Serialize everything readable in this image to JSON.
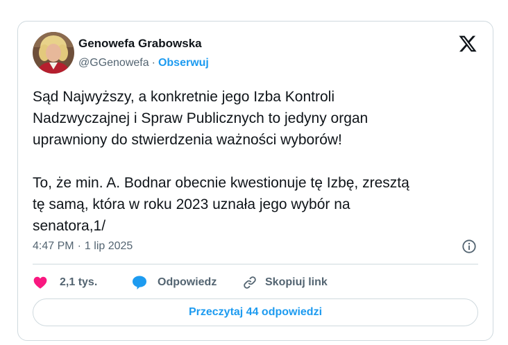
{
  "author": {
    "name": "Genowefa Grabowska",
    "handle": "@GGenowefa",
    "separator": "·",
    "follow_label": "Obserwuj",
    "avatar_icon": "profile-photo"
  },
  "platform_icon": "x-logo-icon",
  "tweet": {
    "text": "Sąd Najwyższy, a konkretnie jego Izba Kontroli\nNadzwyczajnej i Spraw Publicznych to jedyny organ\nuprawniony do stwierdzenia ważności wyborów!\n\nTo, że min. A. Bodnar obecnie kwestionuje tę Izbę, zresztą\ntę samą, która w roku 2023 uznała jego wybór na\nsenatora,1/"
  },
  "meta": {
    "time": "4:47 PM",
    "separator": "·",
    "date": "1 lip 2025"
  },
  "actions": {
    "likes": "2,1 tys.",
    "reply_label": "Odpowiedz",
    "copy_link_label": "Skopiuj link"
  },
  "read_replies_label": "Przeczytaj 44 odpowiedzi",
  "colors": {
    "accent": "#1d9bf0",
    "like": "#f91880",
    "text": "#0f1419",
    "secondary": "#536471",
    "border": "#cfd9de"
  }
}
